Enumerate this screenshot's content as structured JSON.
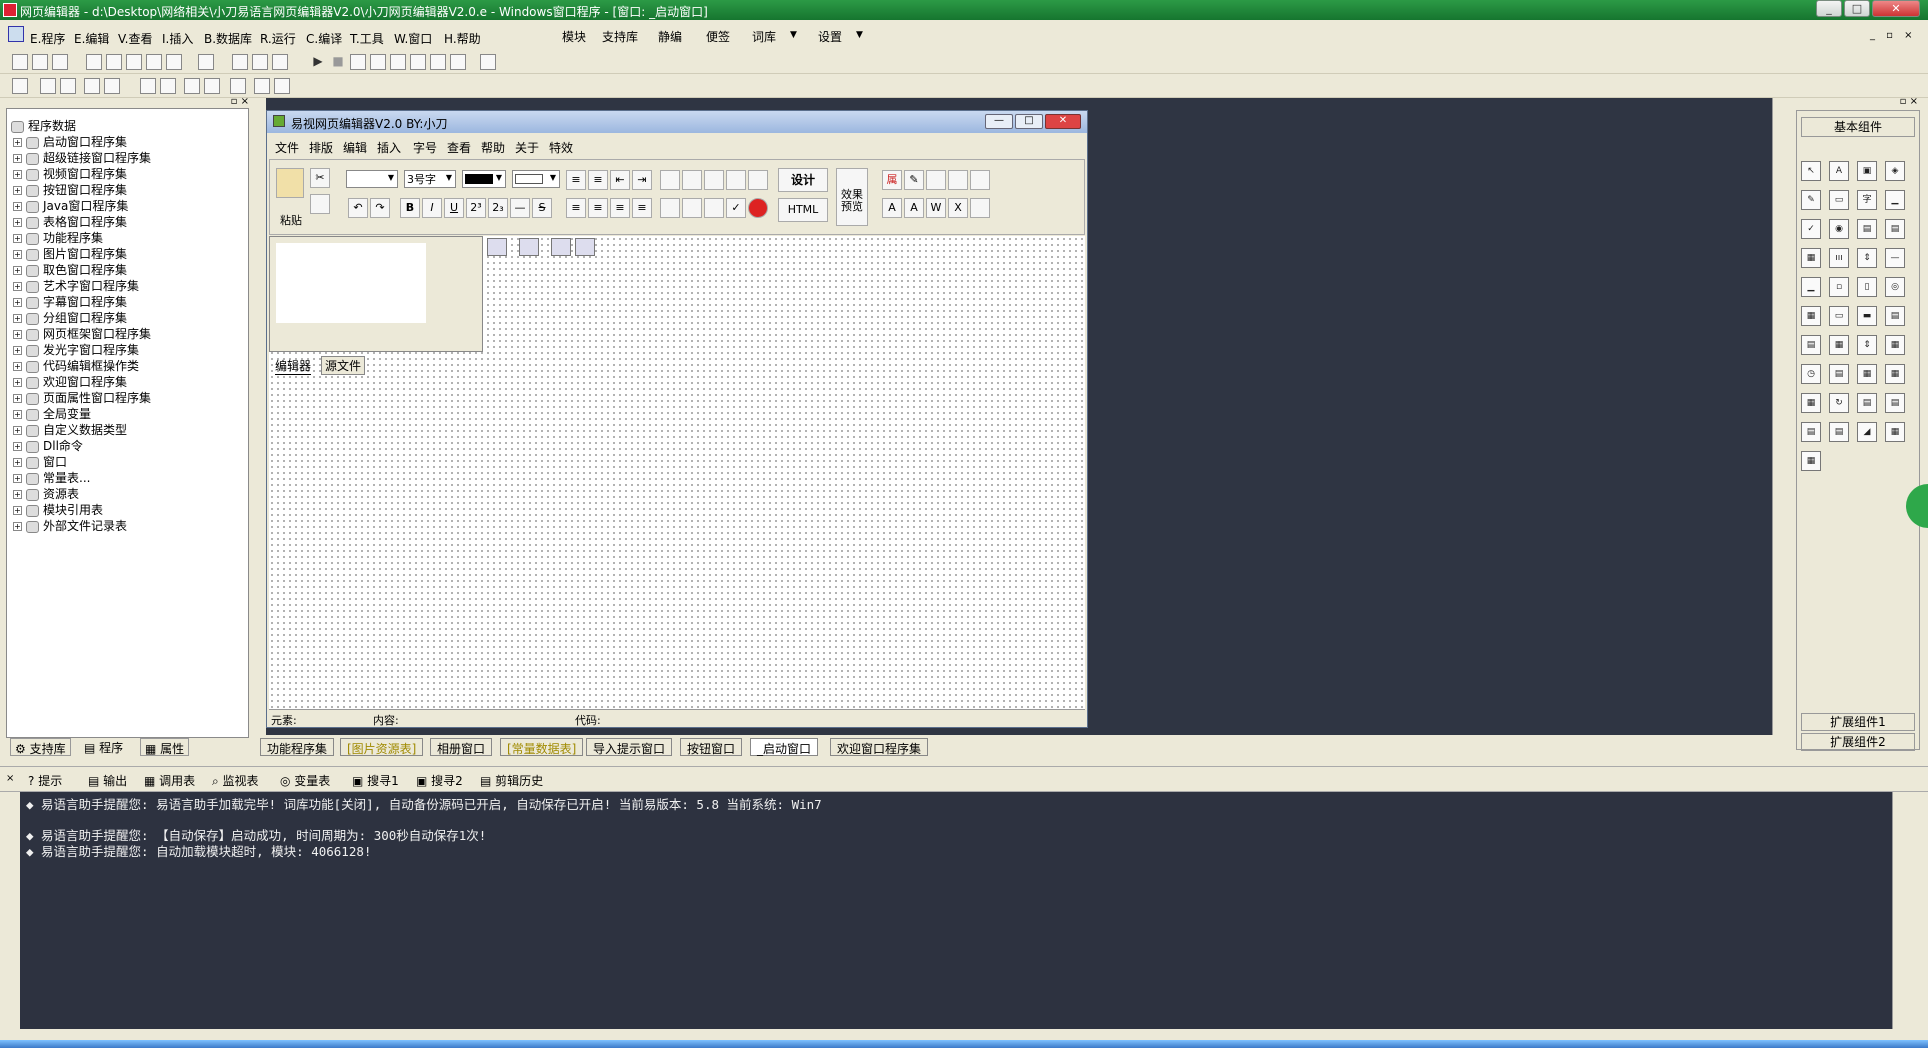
{
  "window": {
    "title": "网页编辑器 - d:\\Desktop\\网络相关\\小刀易语言网页编辑器V2.0\\小刀网页编辑器V2.0.e - Windows窗口程序 - [窗口: _启动窗口]",
    "minimize": "_",
    "restore": "□",
    "close": "✕"
  },
  "menu": {
    "items": [
      "E.程序",
      "E.编辑",
      "V.查看",
      "I.插入",
      "B.数据库",
      "R.运行",
      "C.编译",
      "T.工具",
      "W.窗口",
      "H.帮助"
    ],
    "right_items": [
      "模块",
      "支持库",
      "静编",
      "便签",
      "词库",
      "设置"
    ]
  },
  "tree": {
    "root": "程序数据",
    "items": [
      "启动窗口程序集",
      "超级链接窗口程序集",
      "视频窗口程序集",
      "按钮窗口程序集",
      "Java窗口程序集",
      "表格窗口程序集",
      "功能程序集",
      "图片窗口程序集",
      "取色窗口程序集",
      "艺术字窗口程序集",
      "字幕窗口程序集",
      "分组窗口程序集",
      "网页框架窗口程序集",
      "发光字窗口程序集",
      "代码编辑框操作类",
      "欢迎窗口程序集",
      "页面属性窗口程序集",
      "全局变量",
      "自定义数据类型",
      "Dll命令",
      "窗口",
      "常量表...",
      "资源表",
      "模块引用表",
      "外部文件记录表"
    ]
  },
  "left_tabs": [
    "支持库",
    "程序",
    "属性"
  ],
  "subwindow": {
    "title": "易视网页编辑器V2.0 BY:小刀",
    "menu": [
      "文件",
      "排版",
      "编辑",
      "插入",
      "字号",
      "查看",
      "帮助",
      "关于",
      "特效"
    ],
    "paste_label": "粘贴",
    "font_size": "3号字",
    "design_btn": "设计",
    "html_btn": "HTML",
    "preview_btn": "效果预览",
    "tabs": [
      "编辑器",
      "源文件"
    ],
    "status": [
      "元素:",
      "内容:",
      "代码:"
    ]
  },
  "right_panel": {
    "header": "基本组件",
    "footer": [
      "扩展组件1",
      "扩展组件2"
    ]
  },
  "file_tabs": [
    "功能程序集",
    "[图片资源表]",
    "相册窗口",
    "[常量数据表]",
    "导入提示窗口",
    "按钮窗口",
    "_启动窗口",
    "欢迎窗口程序集"
  ],
  "output_tabs": [
    "提示",
    "输出",
    "调用表",
    "监视表",
    "变量表",
    "搜寻1",
    "搜寻2",
    "剪辑历史"
  ],
  "output": {
    "lines": [
      "◆ 易语言助手提醒您:  易语言助手加载完毕! 词库功能[关闭], 自动备份源码已开启, 自动保存已开启!  当前易版本: 5.8  当前系统: Win7",
      "",
      "◆ 易语言助手提醒您: 【自动保存】启动成功, 时间周期为: 300秒自动保存1次!",
      "◆ 易语言助手提醒您: 自动加载模块超时, 模块: 4066128!"
    ]
  }
}
